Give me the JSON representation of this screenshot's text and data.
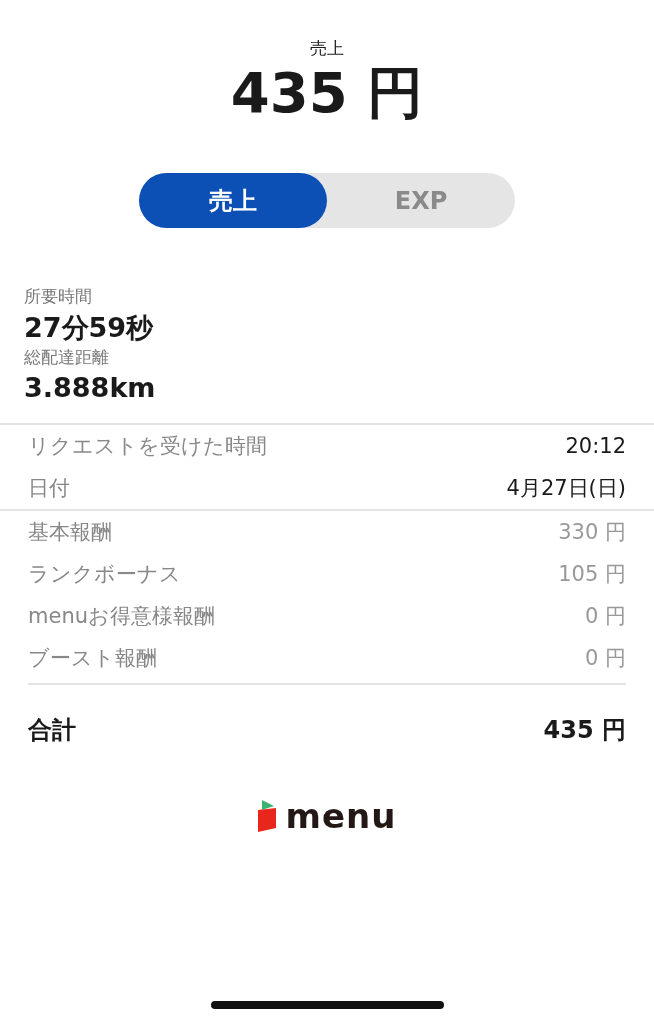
{
  "header": {
    "label": "売上",
    "amount": "435 円"
  },
  "toggle": [
    {
      "label": "売上",
      "selected": true
    },
    {
      "label": "EXP",
      "selected": false
    }
  ],
  "stats": [
    {
      "label": "所要時間",
      "value": "27分59秒"
    },
    {
      "label": "総配達距離",
      "value": "3.888km"
    }
  ],
  "info_rows": [
    {
      "label": "リクエストを受けた時間",
      "value": "20:12"
    },
    {
      "label": "日付",
      "value": "4月27日(日)"
    }
  ],
  "fee_rows": [
    {
      "label": "基本報酬",
      "value": "330 円"
    },
    {
      "label": "ランクボーナス",
      "value": "105 円"
    },
    {
      "label": "menuお得意様報酬",
      "value": "0 円"
    },
    {
      "label": "ブースト報酬",
      "value": "0 円"
    }
  ],
  "total": {
    "label": "合計",
    "value": "435 円"
  },
  "logo": {
    "text": "menu"
  }
}
